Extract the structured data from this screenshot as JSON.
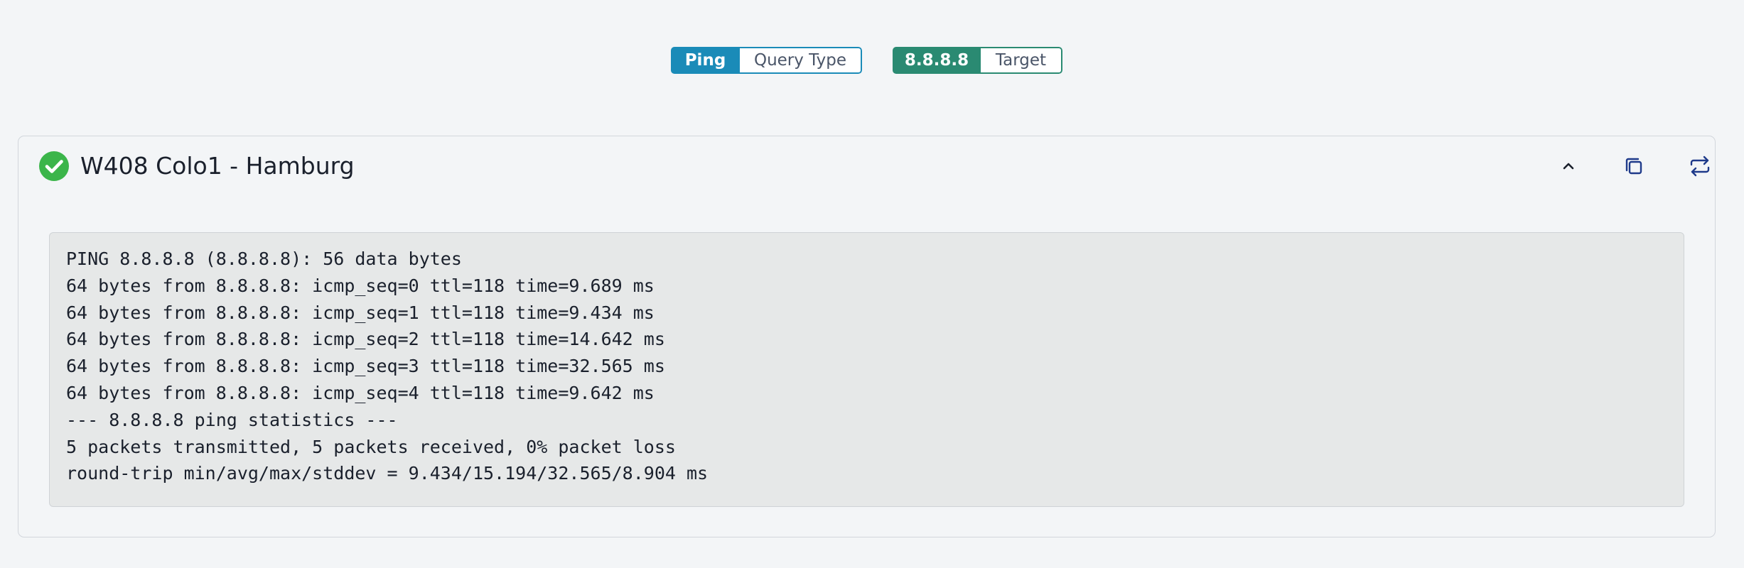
{
  "query": {
    "type_value": "Ping",
    "type_label": "Query Type",
    "target_value": "8.8.8.8",
    "target_label": "Target"
  },
  "colors": {
    "query_tag": "#1a8bb8",
    "target_tag": "#2a8a72",
    "success": "#3bb54a",
    "icon_blue": "#1e3a8a"
  },
  "result": {
    "location": "W408 Colo1 - Hamburg",
    "status_icon": "check-circle-icon",
    "actions": {
      "collapse_icon": "chevron-up-icon",
      "copy_icon": "copy-icon",
      "refresh_icon": "refresh-icon"
    },
    "output": [
      "PING 8.8.8.8 (8.8.8.8): 56 data bytes",
      "64 bytes from 8.8.8.8: icmp_seq=0 ttl=118 time=9.689 ms",
      "64 bytes from 8.8.8.8: icmp_seq=1 ttl=118 time=9.434 ms",
      "64 bytes from 8.8.8.8: icmp_seq=2 ttl=118 time=14.642 ms",
      "64 bytes from 8.8.8.8: icmp_seq=3 ttl=118 time=32.565 ms",
      "64 bytes from 8.8.8.8: icmp_seq=4 ttl=118 time=9.642 ms",
      "--- 8.8.8.8 ping statistics ---",
      "5 packets transmitted, 5 packets received, 0% packet loss",
      "round-trip min/avg/max/stddev = 9.434/15.194/32.565/8.904 ms"
    ]
  }
}
